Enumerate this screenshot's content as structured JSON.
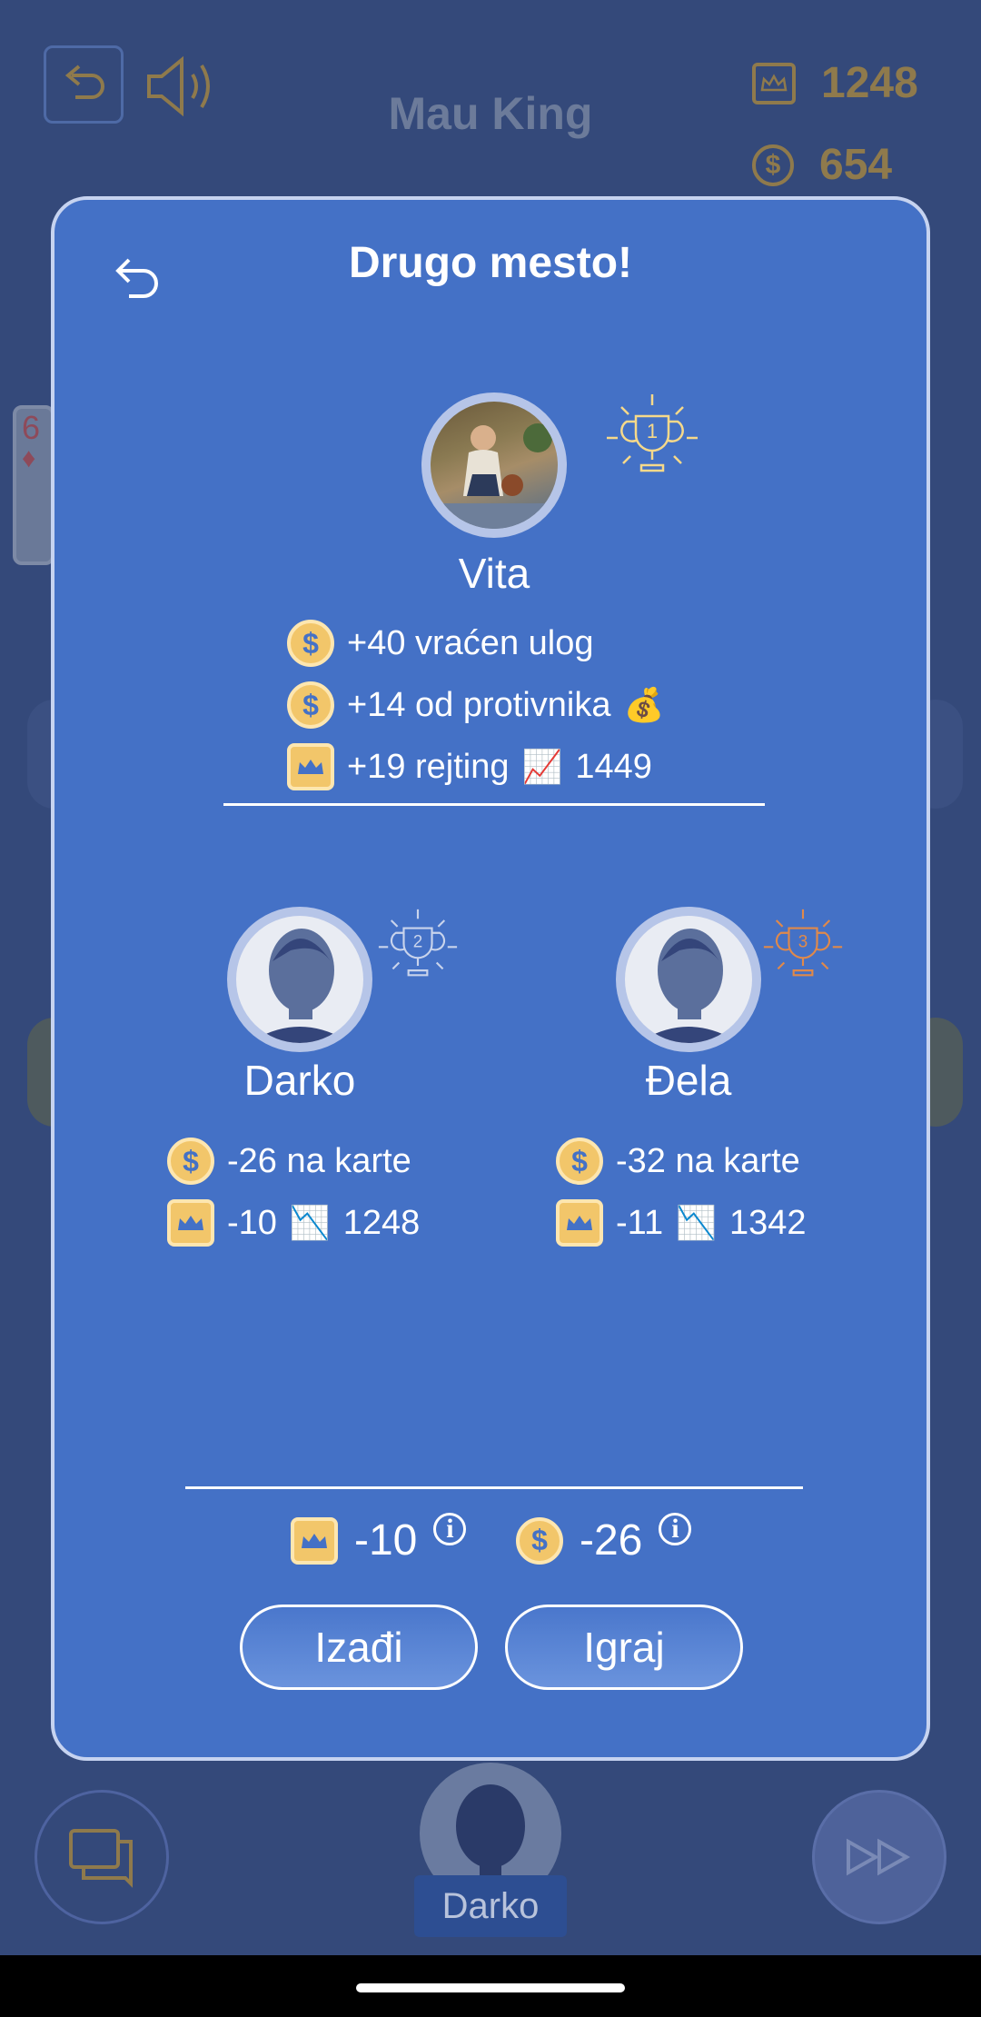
{
  "header": {
    "title": "Mau King",
    "rating": "1248",
    "coins": "654"
  },
  "side_card": {
    "rank": "6",
    "suit": "♦"
  },
  "modal": {
    "title": "Drugo mesto!",
    "winner": {
      "name": "Vita",
      "place": "1",
      "lines": [
        {
          "text": "+40 vraćen ulog"
        },
        {
          "text": "+14 od protivnika",
          "emoji": "💰"
        },
        {
          "text": "+19 rejting",
          "emoji": "📈",
          "rating": "1449"
        }
      ]
    },
    "players": [
      {
        "name": "Darko",
        "place": "2",
        "coins_text": "-26 na karte",
        "rating_delta": "-10",
        "emoji": "📉",
        "rating": "1248"
      },
      {
        "name": "Đela",
        "place": "3",
        "coins_text": "-32 na karte",
        "rating_delta": "-11",
        "emoji": "📉",
        "rating": "1342"
      }
    ],
    "summary": {
      "rating_delta": "-10",
      "coins_delta": "-26",
      "info_glyph": "i"
    },
    "buttons": {
      "exit": "Izađi",
      "play": "Igraj"
    }
  },
  "bottom": {
    "player_name": "Darko"
  },
  "colors": {
    "modal_bg": "#4471c6",
    "gold": "#f2c66a",
    "trophy_gold": "#f6d98a",
    "trophy_silver": "#c9d4ec",
    "trophy_bronze": "#e0894a"
  }
}
